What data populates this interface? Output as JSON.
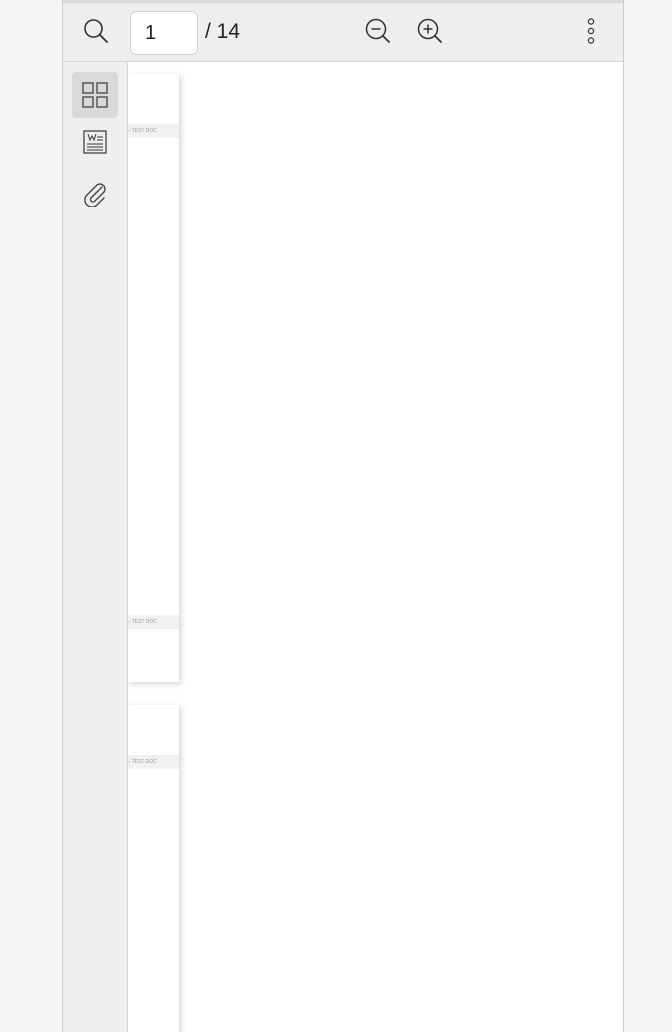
{
  "toolbar": {
    "search_icon": "search-icon",
    "page_number": "1",
    "page_total": "/ 14",
    "zoom_out_icon": "zoom-out-icon",
    "zoom_in_icon": "zoom-in-icon",
    "more_icon": "more-options-icon"
  },
  "sidebar": {
    "items": [
      {
        "icon": "thumbnails-icon",
        "active": true
      },
      {
        "icon": "outline-icon",
        "active": false
      },
      {
        "icon": "attachments-icon",
        "active": false
      }
    ]
  },
  "thumbnails": [
    {
      "header_text": "ENT — TEST DOC",
      "footer_text": "ENT — TEST DOC"
    },
    {
      "header_text": "ENT — TEST DOC"
    }
  ],
  "colors": {
    "toolbar_bg": "#eeeeee",
    "active_sidebar_bg": "#d9d9d9",
    "page_bg": "#ffffff"
  }
}
